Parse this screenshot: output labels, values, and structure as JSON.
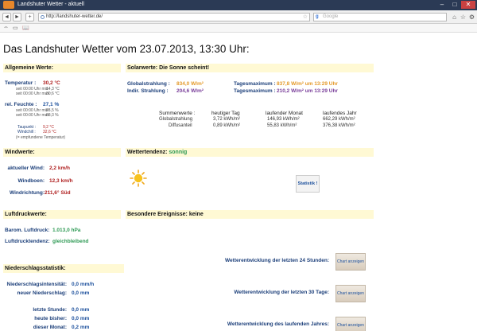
{
  "window": {
    "title": "Landshuter Wetter - aktuell",
    "min": "–",
    "max": "□",
    "close": "✕"
  },
  "toolbar": {
    "back": "◄",
    "forward": "►",
    "add": "+",
    "url": "http://landshuter-wetter.de/",
    "search_placeholder": "Google",
    "search_logo": "g",
    "bookmark_star": "☆",
    "home": "⌂",
    "favorites": "☆",
    "settings": "⚙"
  },
  "bookmarks": {
    "item1": "⇔",
    "item2": "▭",
    "item3": "📖"
  },
  "page": {
    "title": "Das Landshuter Wetter vom 23.07.2013, 13:30 Uhr:",
    "general": {
      "header": "Allgemeine Werte:",
      "temp_label": "Temperatur :",
      "temp_value": "30,2 °C",
      "temp_sub1_label": "seit 00:00 Uhr min :",
      "temp_sub1_value": "14,3 °C",
      "temp_sub2_label": "seit 00:00 Uhr max :",
      "temp_sub2_value": "30,6 °C",
      "hum_label": "rel. Feuchte :",
      "hum_value": "27,1 %",
      "hum_sub1_label": "seit 00:00 Uhr min :",
      "hum_sub1_value": "26,5 %",
      "hum_sub2_label": "seit 00:00 Uhr max :",
      "hum_sub2_value": "83,3 %",
      "dew_label": "Taupunkt :",
      "dew_value": "9,2 °C",
      "chill_label": "Windchill :",
      "chill_value": "32,6 °C",
      "note": "(= empfundene Temperatur)"
    },
    "solar": {
      "header": "Solarwerte:",
      "header_value": "Die Sonne scheint!",
      "global_label": "Globalstrahlung :",
      "global_value": "834,0 W/m²",
      "global_max_label": "Tagesmaximum :",
      "global_max_value": "837,8 W/m² um 13:29 Uhr",
      "indir_label": "Indir. Strahlung :",
      "indir_value": "204,6 W/m²",
      "indir_max_label": "Tagesmaximum :",
      "indir_max_value": "210,2 W/m² um 13:29 Uhr",
      "sum_label": "Summenwerte :",
      "col_today": "heutiger Tag",
      "col_month": "laufender Monat",
      "col_year": "laufendes Jahr",
      "row1_label": "Globalstrahlung",
      "row1_today": "3,72 kWh/m²",
      "row1_month": "146,93 kWh/m²",
      "row1_year": "662,29 kWh/m²",
      "row2_label": "Diffusanteil",
      "row2_today": "0,89 kWh/m²",
      "row2_month": "55,83 kWh/m²",
      "row2_year": "376,38 kWh/m²"
    },
    "wind": {
      "header": "Windwerte:",
      "current_label": "aktueller Wind:",
      "current_value": "2,2 km/h",
      "gust_label": "Windboen:",
      "gust_value": "12,3 km/h",
      "dir_label": "Windrichtung:",
      "dir_value": "211,6° Süd"
    },
    "tendency": {
      "header": "Wettertendenz:",
      "header_value": "sonnig",
      "stat_button": "Statistik !"
    },
    "pressure": {
      "header": "Luftdruckwerte:",
      "baro_label": "Barom. Luftdruck:",
      "baro_value": "1.013,0 hPa",
      "trend_label": "Luftdrucktendenz:",
      "trend_value": "gleichbleibend"
    },
    "events": {
      "header": "Besondere Ereignisse:",
      "header_value": "keine"
    },
    "precip": {
      "header": "Niederschlagsstatistik:",
      "intensity_label": "Niederschlagsintensität:",
      "intensity_value": "0,0 mm/h",
      "new_label": "neuer Niederschlag:",
      "new_value": "0,0 mm",
      "lasthour_label": "letzte Stunde:",
      "lasthour_value": "0,0 mm",
      "today_label": "heute bisher:",
      "today_value": "0,0 mm",
      "month_label": "dieser Monat:",
      "month_value": "0,2 mm"
    },
    "charts": {
      "t24_label": "Wetterentwicklung der letzten 24 Stunden:",
      "t30_label": "Wetterentwicklung der letzten 30 Tage:",
      "year_label": "Wetterentwicklung des laufenden Jahres:",
      "button_label": "Chart anzeigen"
    }
  }
}
